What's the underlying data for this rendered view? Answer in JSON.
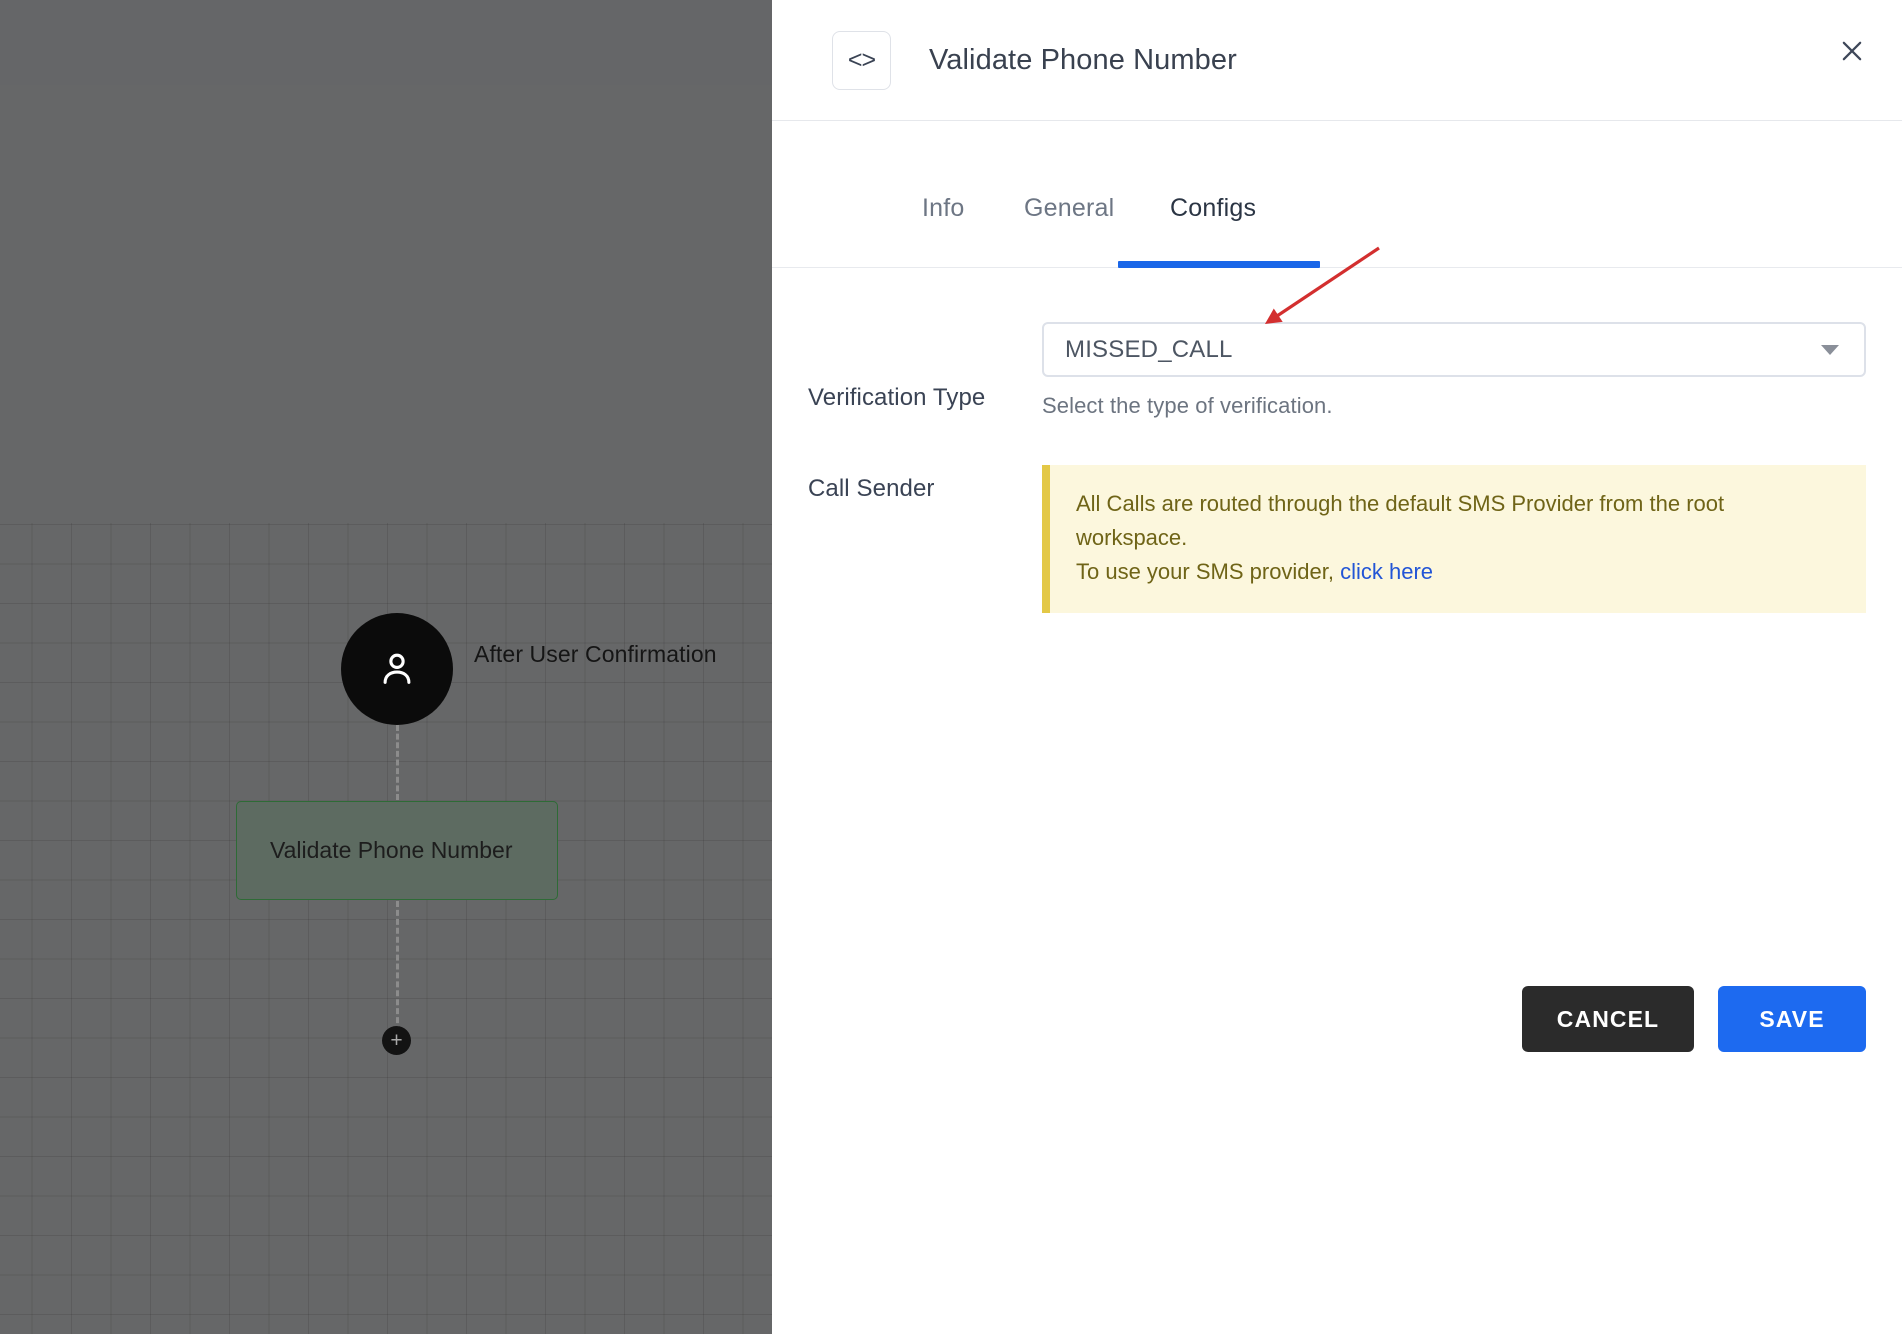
{
  "canvas": {
    "start_node": {
      "icon": "user-icon",
      "caption": "After User Confirmation"
    },
    "step_node": {
      "label": "Validate Phone Number"
    },
    "add_button_label": "+"
  },
  "panel": {
    "header": {
      "icon": "code-brackets-icon",
      "icon_glyph": "<>",
      "title": "Validate Phone Number",
      "close_icon": "close-icon"
    },
    "tabs": [
      {
        "label": "Info",
        "active": false
      },
      {
        "label": "General",
        "active": false
      },
      {
        "label": "Configs",
        "active": true
      }
    ],
    "fields": {
      "verification_type": {
        "label": "Verification Type",
        "value": "MISSED_CALL",
        "help": "Select the type of verification.",
        "caret_icon": "chevron-down-icon"
      },
      "call_sender": {
        "label": "Call Sender",
        "alert_line1": "All Calls are routed through the default SMS Provider from the root workspace.",
        "alert_line2_prefix": "To use your SMS provider, ",
        "alert_link": "click here"
      }
    },
    "buttons": {
      "cancel": "CANCEL",
      "save": "SAVE"
    }
  },
  "colors": {
    "accent_blue": "#1a66e8",
    "save_blue": "#1d6af0",
    "cancel_dark": "#2b2b2b",
    "alert_bg": "#fcf7dd",
    "alert_border": "#e3c846",
    "alert_text": "#6f6417",
    "link_blue": "#2255d6",
    "node_green_border": "#2e6b36",
    "annotation_red": "#d32f2f"
  },
  "annotation": {
    "type": "arrow",
    "color": "#d32f2f",
    "points_to": "verification-type-select"
  }
}
